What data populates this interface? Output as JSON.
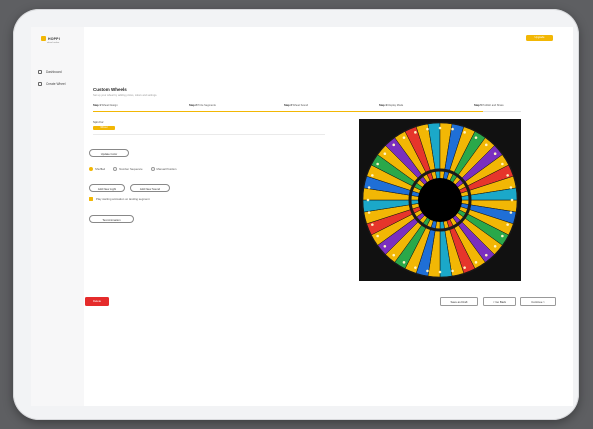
{
  "app": {
    "logo_text": "HOPPI",
    "logo_sub": "wheel maker"
  },
  "sidebar": {
    "items": [
      {
        "label": "Dashboard",
        "icon": "home-icon"
      },
      {
        "label": "Create Wheel",
        "icon": "wheel-icon"
      }
    ]
  },
  "header": {
    "top_button_label": "Upgrade"
  },
  "page": {
    "title": "Custom Wheels",
    "subtitle": "Set up your wheel by adding prizes, colors and settings."
  },
  "steps": [
    {
      "number": "Step 1",
      "label": "Wheel Design"
    },
    {
      "number": "Step 2",
      "label": "Prize Segments"
    },
    {
      "number": "Step 3",
      "label": "Wheel Sound"
    },
    {
      "number": "Step 4",
      "label": "Display Mode"
    },
    {
      "number": "Step 5",
      "label": "Publish and Share"
    }
  ],
  "form": {
    "field_label": "Spin For",
    "chip_value": "Winner",
    "update_button": "Update Color",
    "radio_options": [
      {
        "label": "Shuffled",
        "selected": true
      },
      {
        "label": "Number Sequence",
        "selected": false
      },
      {
        "label": "Manual Position",
        "selected": false
      }
    ],
    "action_buttons": [
      "Add New Light",
      "Add New Sound"
    ],
    "checkbox_label": "Play starting animation on landing segment",
    "checkbox_checked": true,
    "test_button": "Test Animation"
  },
  "footer": {
    "delete_label": "Delete",
    "save_label": "Save as Draft",
    "back_label": "< Go Back",
    "continue_label": "Continue >"
  },
  "colors": {
    "accent": "#f2b705",
    "danger": "#e52b2b",
    "wheel_segments": [
      "#f2b705",
      "#1f6fd6",
      "#f2b705",
      "#2aa84a",
      "#f2b705",
      "#7a2fbf",
      "#f2b705",
      "#e6352b",
      "#f2b705",
      "#1ba8c9"
    ]
  }
}
